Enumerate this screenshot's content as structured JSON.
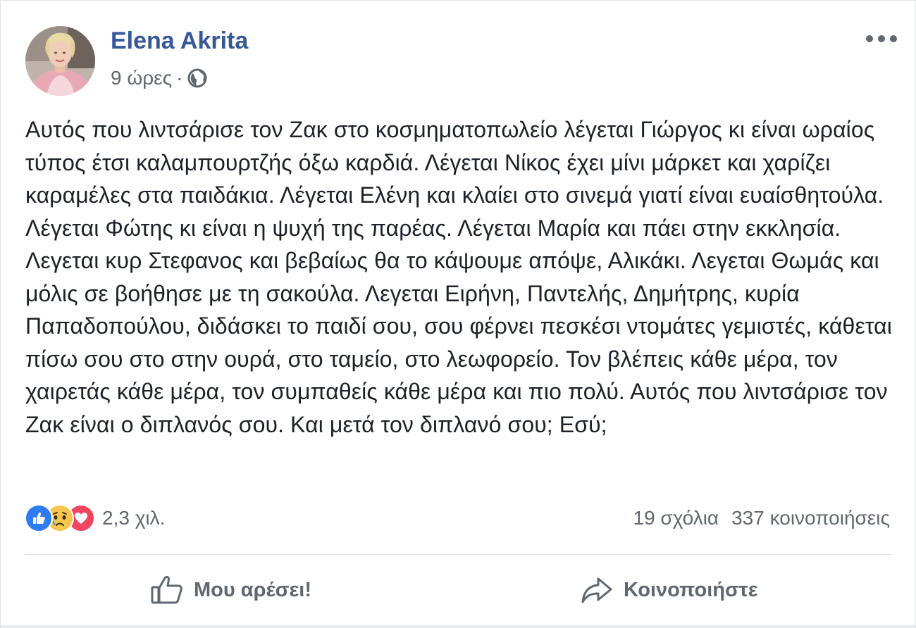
{
  "post": {
    "author": "Elena Akrita",
    "time": "9 ώρες",
    "separator": "·",
    "audience_icon": "globe-icon",
    "text": "Αυτός που λιντσάρισε τον Ζακ στο κοσμηματοπωλείο λέγεται Γιώργος κι είναι ωραίος τύπος έτσι καλαμπουρτζής όξω καρδιά. Λέγεται Νίκος έχει μίνι μάρκετ και χαρίζει καραμέλες στα παιδάκια. Λέγεται Ελένη και κλαίει στο σινεμά γιατί είναι ευαίσθητούλα. Λέγεται Φώτης κι είναι η ψυχή της παρέας. Λέγεται Μαρία και πάει στην εκκλησία. Λεγεται κυρ Στεφανος και βεβαίως θα το κάψουμε απόψε, Αλικάκι. Λεγεται Θωμάς και μόλις σε βοήθησε με τη σακούλα. Λεγεται Ειρήνη, Παντελής, Δημήτρης, κυρία Παπαδοπούλου, διδάσκει το παιδί σου, σου φέρνει πεσκέσι ντομάτες γεμιστές, κάθεται πίσω σου στο στην ουρά, στο ταμείο, στο λεωφορείο. Τον βλέπεις κάθε μέρα, τον χαιρετάς κάθε μέρα, τον συμπαθείς κάθε μέρα και πιο πολύ. Αυτός που λιντσάρισε τον Ζακ είναι ο διπλανός σου. Και μετά τον διπλανό σου; Εσύ;"
  },
  "reactions": {
    "icons": [
      "like-reaction-icon",
      "sad-reaction-icon",
      "love-reaction-icon"
    ],
    "count": "2,3 χιλ.",
    "colors": {
      "like": "#2f7bf0",
      "sad": "#f7c64a",
      "love": "#f0455f"
    }
  },
  "stats": {
    "comments": "19 σχόλια",
    "shares": "337 κοινοποιήσεις"
  },
  "actions": {
    "like_label": "Μου αρέσει!",
    "share_label": "Κοινοποιήστε"
  },
  "theme": {
    "author_color": "#365899",
    "text_color": "#1d2129",
    "muted_color": "#616770"
  }
}
